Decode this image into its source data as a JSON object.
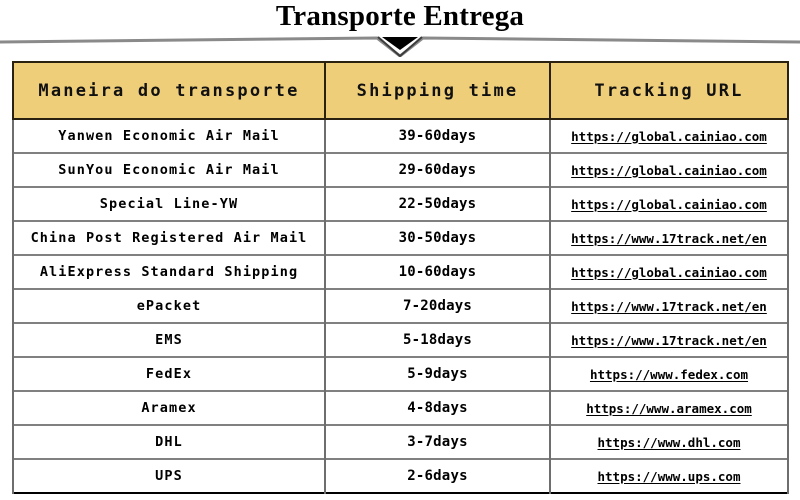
{
  "header": {
    "title": "Transporte Entrega",
    "divider_icon": "chevron-down-icon"
  },
  "table": {
    "columns": [
      {
        "key": "method",
        "label": "Maneira do transporte"
      },
      {
        "key": "time",
        "label": "Shipping time"
      },
      {
        "key": "url",
        "label": "Tracking URL"
      }
    ],
    "header_bg": "#EFCE7A",
    "header_border": "#2B2111",
    "row_border": "#6E6E6E",
    "rows": [
      {
        "method": "Yanwen Economic Air Mail",
        "time": "39-60days",
        "url": "https://global.cainiao.com"
      },
      {
        "method": "SunYou Economic Air Mail",
        "time": "29-60days",
        "url": "https://global.cainiao.com"
      },
      {
        "method": "Special Line-YW",
        "time": "22-50days",
        "url": "https://global.cainiao.com"
      },
      {
        "method": "China Post Registered Air Mail",
        "time": "30-50days",
        "url": "https://www.17track.net/en"
      },
      {
        "method": "AliExpress Standard Shipping",
        "time": "10-60days",
        "url": "https://global.cainiao.com"
      },
      {
        "method": "ePacket",
        "time": "7-20days",
        "url": "https://www.17track.net/en"
      },
      {
        "method": "EMS",
        "time": "5-18days",
        "url": "https://www.17track.net/en"
      },
      {
        "method": "FedEx",
        "time": "5-9days",
        "url": "https://www.fedex.com"
      },
      {
        "method": "Aramex",
        "time": "4-8days",
        "url": "https://www.aramex.com"
      },
      {
        "method": "DHL",
        "time": "3-7days",
        "url": "https://www.dhl.com"
      },
      {
        "method": "UPS",
        "time": "2-6days",
        "url": "https://www.ups.com"
      }
    ]
  }
}
